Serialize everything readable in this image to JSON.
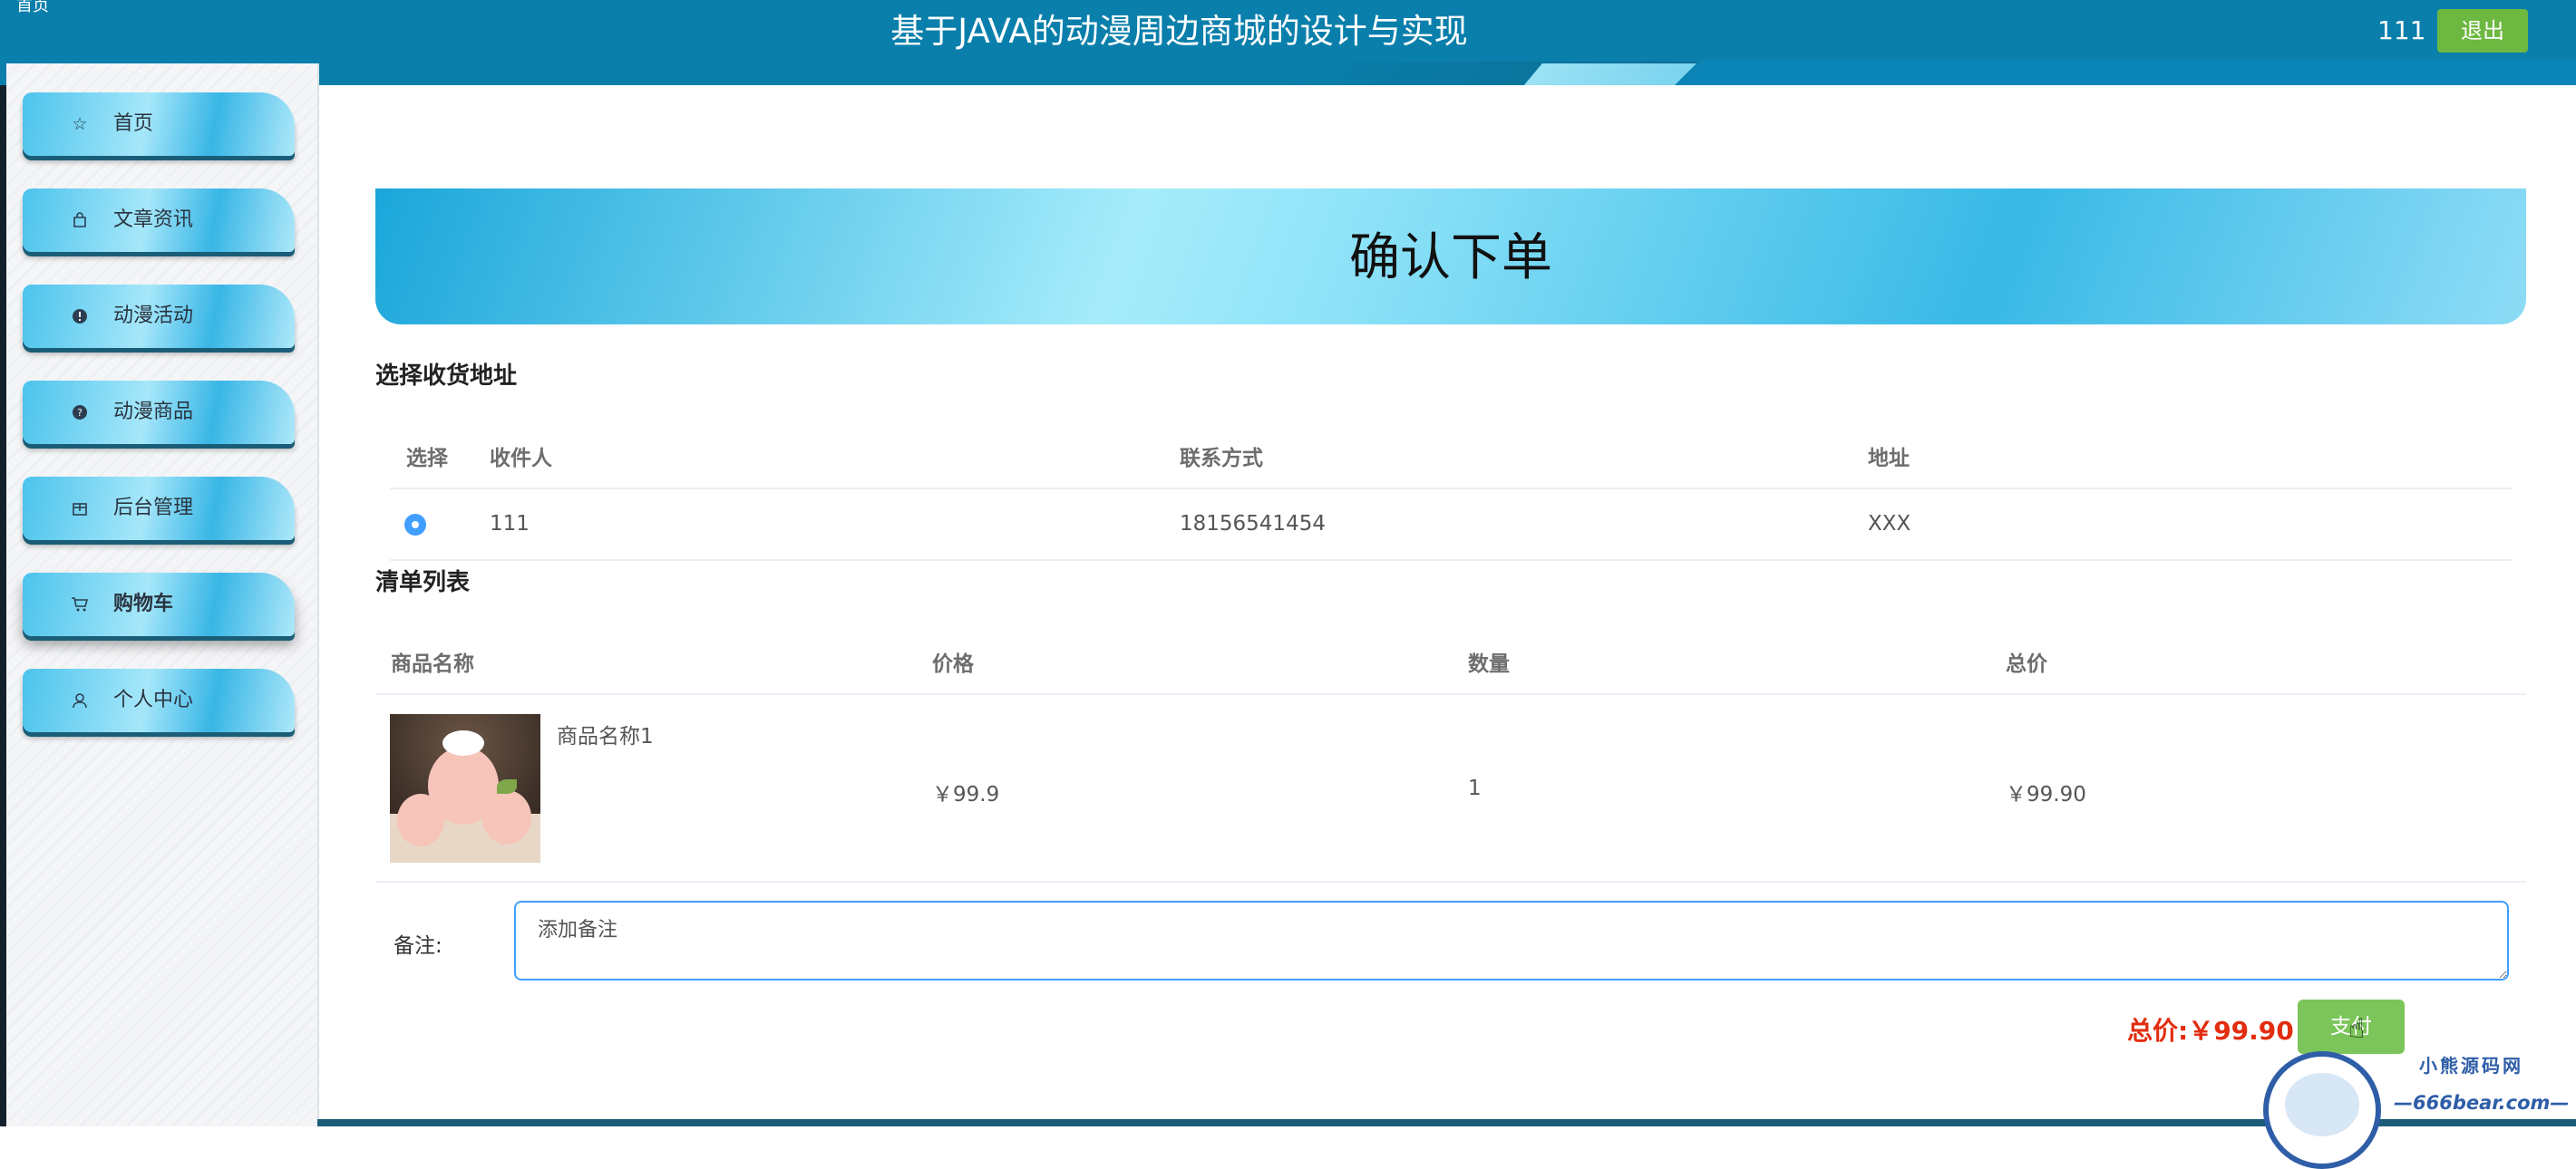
{
  "header": {
    "title": "基于JAVA的动漫周边商城的设计与实现",
    "username": "111",
    "logout_label": "退出",
    "corner_text": "首页"
  },
  "sidebar": {
    "items": [
      {
        "label": "首页",
        "icon": "star-icon"
      },
      {
        "label": "文章资讯",
        "icon": "bag-icon"
      },
      {
        "label": "动漫活动",
        "icon": "exclamation-icon"
      },
      {
        "label": "动漫商品",
        "icon": "question-icon"
      },
      {
        "label": "后台管理",
        "icon": "box-icon"
      },
      {
        "label": "购物车",
        "icon": "cart-icon",
        "active": true
      },
      {
        "label": "个人中心",
        "icon": "user-icon"
      }
    ]
  },
  "main": {
    "banner_title": "确认下单",
    "address_section": {
      "title": "选择收货地址",
      "columns": [
        "选择",
        "收件人",
        "联系方式",
        "地址"
      ],
      "rows": [
        {
          "selected": true,
          "recipient": "111",
          "phone": "18156541454",
          "address": "XXX"
        }
      ]
    },
    "order_section": {
      "title": "清单列表",
      "columns": [
        "商品名称",
        "价格",
        "数量",
        "总价"
      ],
      "rows": [
        {
          "name": "商品名称1",
          "price": "￥99.9",
          "quantity": "1",
          "total": "￥99.90"
        }
      ]
    },
    "remark": {
      "label": "备注:",
      "value": "添加备注"
    },
    "total_label": "总价:￥99.90",
    "pay_label": "支付"
  },
  "watermark": {
    "line1": "小熊源码网",
    "line2": "—666bear.com—"
  },
  "colors": {
    "header_bg": "#0a7fab",
    "accent_green": "#6cb840",
    "total_red": "#e22d0f",
    "radio_blue": "#409eff"
  }
}
